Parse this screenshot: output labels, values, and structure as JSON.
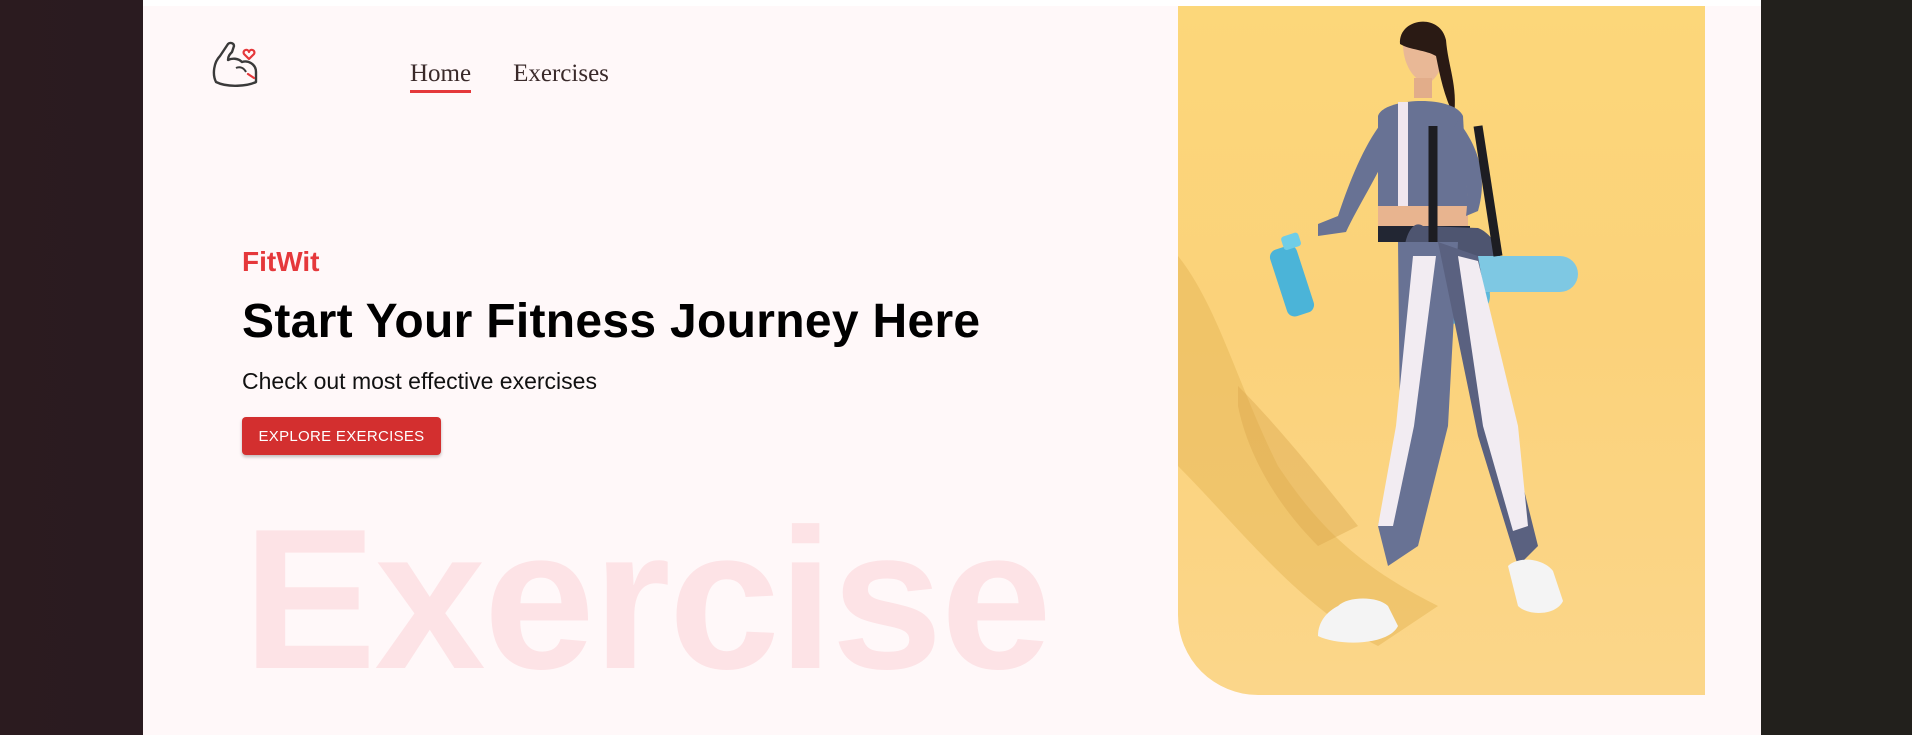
{
  "nav": {
    "items": [
      {
        "label": "Home",
        "active": true
      },
      {
        "label": "Exercises",
        "active": false
      }
    ]
  },
  "hero": {
    "brand": "FitWit",
    "headline": "Start Your Fitness Journey Here",
    "subtitle": "Check out most effective exercises",
    "cta_label": "EXPLORE EXERCISES",
    "background_word": "Exercise"
  },
  "icons": {
    "logo": "flexed-arm-heart-icon"
  },
  "colors": {
    "accent": "#e5383b",
    "button": "#d32f2f",
    "page_bg": "#fff8f9",
    "bg_word": "#fde3e6",
    "hero_bg": "#fcd77a"
  }
}
